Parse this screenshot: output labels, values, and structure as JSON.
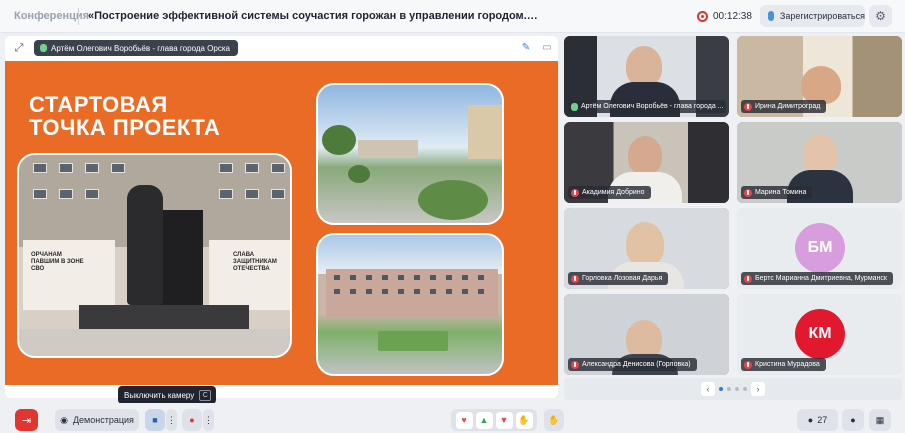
{
  "header": {
    "app_name": "Конференция",
    "title": "«Построение эффективной системы соучастия горожан в управлении городом. Формирование эк...",
    "timer": "00:12:38",
    "register_label": "Зарегистрироваться"
  },
  "stage": {
    "speaker": "Артём Олегович Воробьёв - глава города Орска",
    "slide": {
      "title_line1": "СТАРТОВАЯ",
      "title_line2": "ТОЧКА ПРОЕКТА",
      "monument_text_left": "ОРЧАНАМ ПАВШИМ В ЗОНЕ СВО",
      "monument_text_right": "СЛАВА ЗАЩИТНИКАМ ОТЕЧЕСТВА"
    }
  },
  "participants": [
    {
      "name": "Артём Олегович Воробьёв - глава города ...",
      "mic": "on"
    },
    {
      "name": "Ирина Димитроград",
      "mic": "off"
    },
    {
      "name": "Акадимия Добрино",
      "mic": "off"
    },
    {
      "name": "Марина Томина",
      "mic": "off"
    },
    {
      "name": "Горловка Лозовая Дарья",
      "mic": "off"
    },
    {
      "name": "Бертс Марианна Дмитриевна, Мурманск",
      "mic": "off",
      "initials": "БМ",
      "avatar_color": "#d79ddc"
    },
    {
      "name": "Александра Денисова (Горловка)",
      "mic": "off"
    },
    {
      "name": "Кристина Мурадова",
      "mic": "off",
      "initials": "КМ",
      "avatar_color": "#e2182f"
    }
  ],
  "pager": {
    "prev": "‹",
    "next": "›"
  },
  "toolbar": {
    "demo_label": "Демонстрация",
    "participants_count": "27",
    "tooltip": "Выключить камеру",
    "tooltip_key": "C"
  },
  "colors": {
    "slide_bg": "#ea6b26",
    "leave": "#e2352d",
    "mic_on": "#6fd18b",
    "mic_off": "#e4454a"
  }
}
